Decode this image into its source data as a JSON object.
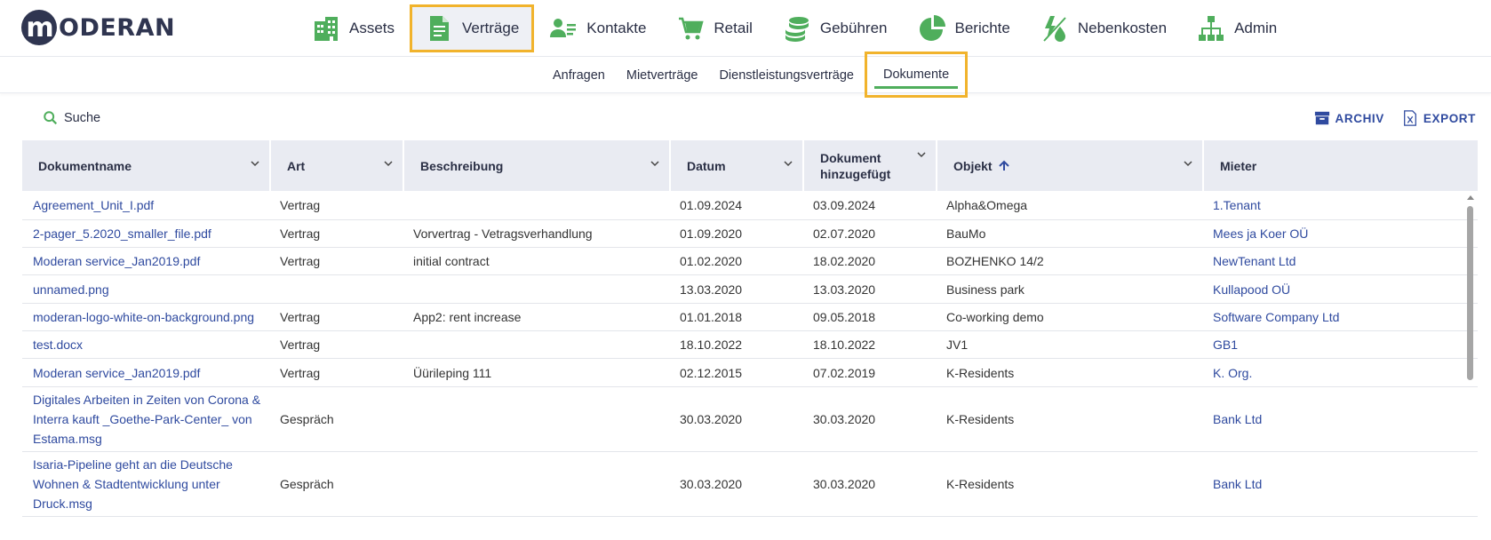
{
  "app": {
    "logo_letter": "m",
    "logo_text": "ODERAN"
  },
  "nav": [
    {
      "label": "Assets",
      "icon": "building-icon",
      "active": false
    },
    {
      "label": "Verträge",
      "icon": "document-icon",
      "active": true
    },
    {
      "label": "Kontakte",
      "icon": "contact-card-icon",
      "active": false
    },
    {
      "label": "Retail",
      "icon": "shopping-cart-icon",
      "active": false
    },
    {
      "label": "Gebühren",
      "icon": "coins-icon",
      "active": false
    },
    {
      "label": "Berichte",
      "icon": "pie-chart-icon",
      "active": false
    },
    {
      "label": "Nebenkosten",
      "icon": "utilities-icon",
      "active": false
    },
    {
      "label": "Admin",
      "icon": "org-chart-icon",
      "active": false
    }
  ],
  "subnav": [
    {
      "label": "Anfragen"
    },
    {
      "label": "Mietverträge"
    },
    {
      "label": "Dienstleistungsverträge"
    },
    {
      "label": "Dokumente",
      "active": true
    }
  ],
  "toolbar": {
    "search_label": "Suche",
    "archive_label": "ARCHIV",
    "export_label": "EXPORT"
  },
  "table": {
    "columns": [
      {
        "label": "Dokumentname"
      },
      {
        "label": "Art"
      },
      {
        "label": "Beschreibung"
      },
      {
        "label": "Datum"
      },
      {
        "label": "Dokument hinzugefügt"
      },
      {
        "label": "Objekt"
      },
      {
        "label": "Mieter"
      }
    ],
    "rows": [
      {
        "name": "Agreement_Unit_I.pdf",
        "art": "Vertrag",
        "desc": "",
        "datum": "01.09.2024",
        "added": "03.09.2024",
        "objekt": "Alpha&Omega",
        "mieter": "1.Tenant"
      },
      {
        "name": "2-pager_5.2020_smaller_file.pdf",
        "art": "Vertrag",
        "desc": "Vorvertrag - Vetragsverhandlung",
        "datum": "01.09.2020",
        "added": "02.07.2020",
        "objekt": "BauMo",
        "mieter": "Mees ja Koer OÜ"
      },
      {
        "name": "Moderan service_Jan2019.pdf",
        "art": "Vertrag",
        "desc": "initial contract",
        "datum": "01.02.2020",
        "added": "18.02.2020",
        "objekt": "BOZHENKO 14/2",
        "mieter": "NewTenant Ltd"
      },
      {
        "name": "unnamed.png",
        "art": "",
        "desc": "",
        "datum": "13.03.2020",
        "added": "13.03.2020",
        "objekt": "Business park",
        "mieter": "Kullapood OÜ"
      },
      {
        "name": "moderan-logo-white-on-background.png",
        "art": "Vertrag",
        "desc": "App2: rent increase",
        "datum": "01.01.2018",
        "added": "09.05.2018",
        "objekt": "Co-working demo",
        "mieter": "Software Company Ltd"
      },
      {
        "name": "test.docx",
        "art": "Vertrag",
        "desc": "",
        "datum": "18.10.2022",
        "added": "18.10.2022",
        "objekt": "JV1",
        "mieter": "GB1"
      },
      {
        "name": "Moderan service_Jan2019.pdf",
        "art": "Vertrag",
        "desc": "Üürileping 111",
        "datum": "02.12.2015",
        "added": "07.02.2019",
        "objekt": "K-Residents",
        "mieter": "K. Org."
      },
      {
        "name": "Digitales Arbeiten in Zeiten von Corona & Interra kauft _Goethe-Park-Center_ von Estama.msg",
        "art": "Gespräch",
        "desc": "",
        "datum": "30.03.2020",
        "added": "30.03.2020",
        "objekt": "K-Residents",
        "mieter": "Bank Ltd"
      },
      {
        "name": "Isaria-Pipeline geht an die Deutsche Wohnen & Stadtentwicklung unter Druck.msg",
        "art": "Gespräch",
        "desc": "",
        "datum": "30.03.2020",
        "added": "30.03.2020",
        "objekt": "K-Residents",
        "mieter": "Bank Ltd"
      }
    ]
  },
  "colors": {
    "accent_green": "#4fae5c",
    "highlight_orange": "#f1b32c",
    "link_blue": "#2f4a9f",
    "header_bg": "#e9ebf2",
    "logo_dark": "#2f3550"
  }
}
